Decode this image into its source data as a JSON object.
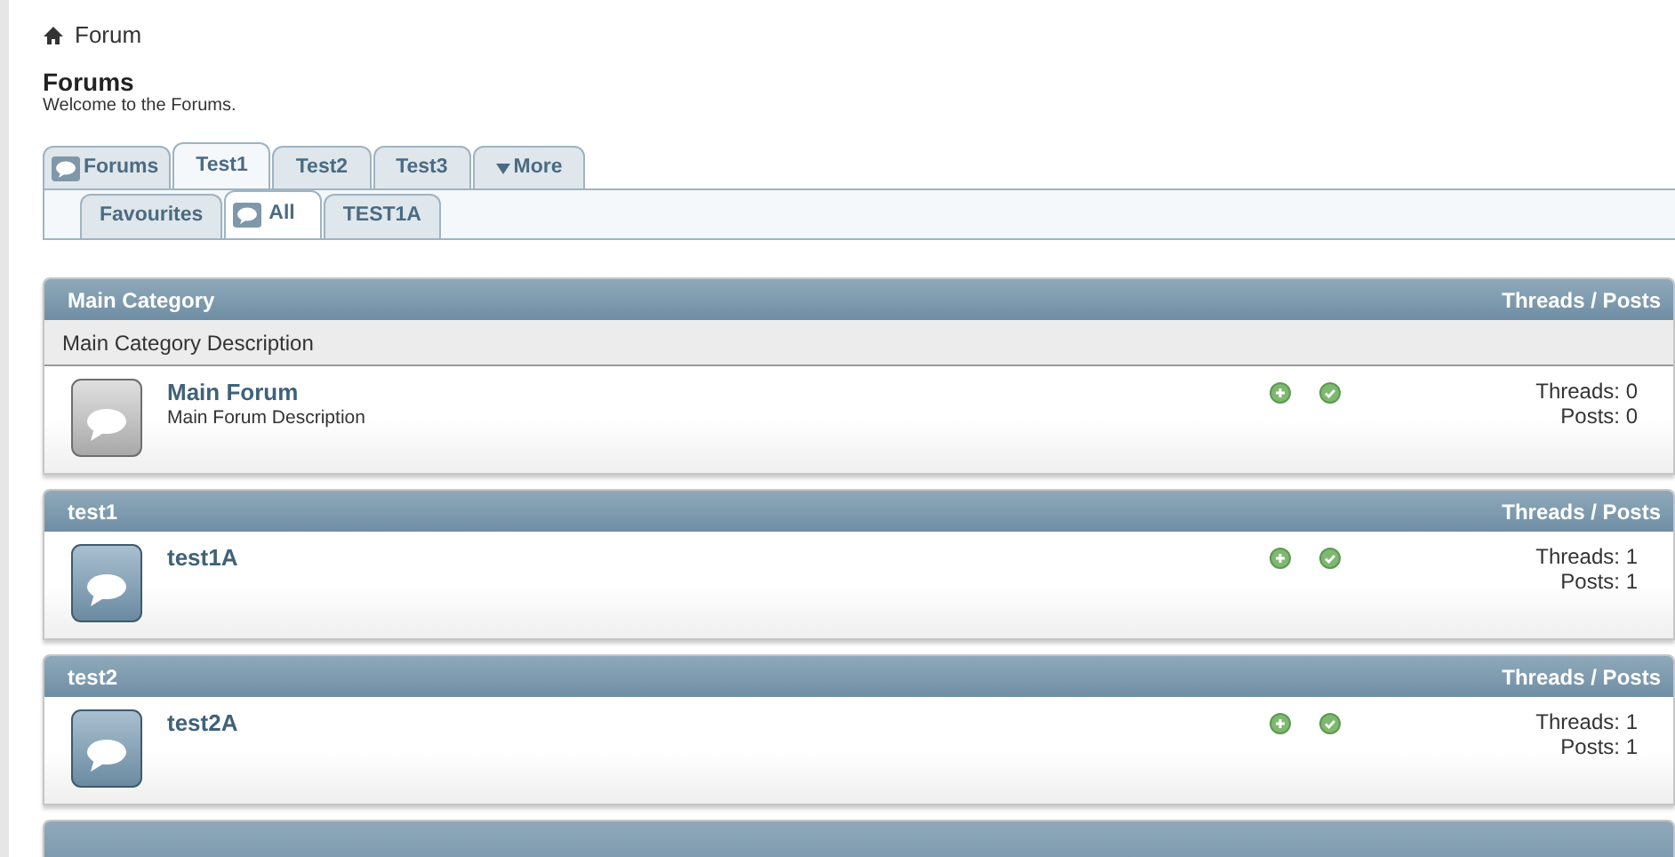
{
  "breadcrumb": {
    "label": "Forum"
  },
  "heading": {
    "title": "Forums",
    "subtitle": "Welcome to the Forums."
  },
  "tabs": [
    {
      "label": "Forums",
      "selected": false,
      "kind": "icon"
    },
    {
      "label": "Test1",
      "selected": true,
      "kind": "plain"
    },
    {
      "label": "Test2",
      "selected": false,
      "kind": "plain"
    },
    {
      "label": "Test3",
      "selected": false,
      "kind": "plain"
    },
    {
      "label": "More",
      "selected": false,
      "kind": "dropdown"
    }
  ],
  "subtabs": [
    {
      "label": "Favourites",
      "selected": false,
      "kind": "plain"
    },
    {
      "label": "All",
      "selected": true,
      "kind": "icon"
    },
    {
      "label": "TEST1A",
      "selected": false,
      "kind": "plain"
    }
  ],
  "categories": [
    {
      "title": "Main Category",
      "stats_heading": "Threads / Posts",
      "description": "Main Category Description",
      "forums": [
        {
          "name": "Main Forum",
          "description": "Main Forum Description",
          "unread": false,
          "threads": "Threads: 0",
          "posts": "Posts: 0"
        }
      ]
    },
    {
      "title": "test1",
      "stats_heading": "Threads / Posts",
      "forums": [
        {
          "name": "test1A",
          "unread": true,
          "threads": "Threads: 1",
          "posts": "Posts: 1"
        }
      ]
    },
    {
      "title": "test2",
      "stats_heading": "Threads / Posts",
      "forums": [
        {
          "name": "test2A",
          "unread": true,
          "threads": "Threads: 1",
          "posts": "Posts: 1"
        }
      ]
    },
    {
      "kind": "cut"
    }
  ]
}
